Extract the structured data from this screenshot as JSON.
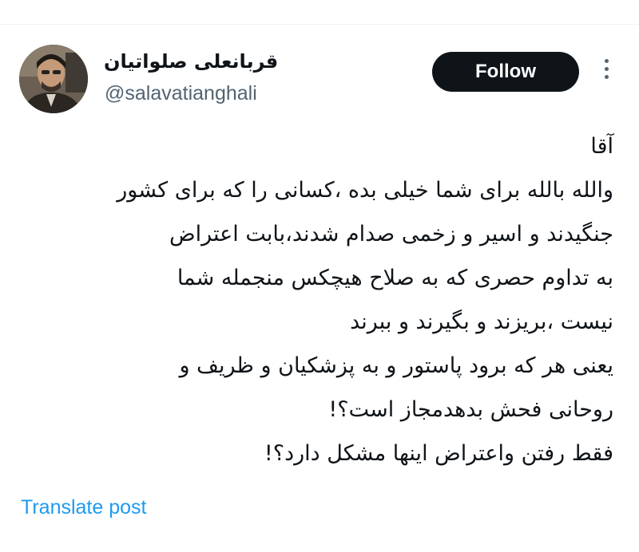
{
  "author": {
    "display_name": "قربانعلی صلواتیان",
    "handle": "@salavatianghali"
  },
  "actions": {
    "follow_label": "Follow",
    "more_icon": "more-horizontal-icon"
  },
  "post": {
    "lines": [
      "آقا",
      "والله بالله برای شما خیلی بده ،کسانی را که برای کشور",
      "جنگیدند و اسیر و زخمی صدام شدند،بابت اعتراض",
      "به تداوم حصری که به صلاح هیچکس منجمله شما",
      "نیست ،بریزند و بگیرند و ببرند",
      "یعنی هر که برود پاستور و به پزشکیان و ظریف و",
      "روحانی فحش بدهدمجاز است؟!",
      "فقط رفتن واعتراض اینها مشکل دارد؟!"
    ]
  },
  "footer": {
    "translate_label": "Translate post"
  },
  "colors": {
    "follow_bg": "#0f1419",
    "link": "#1d9bf0",
    "secondary_text": "#536471"
  }
}
